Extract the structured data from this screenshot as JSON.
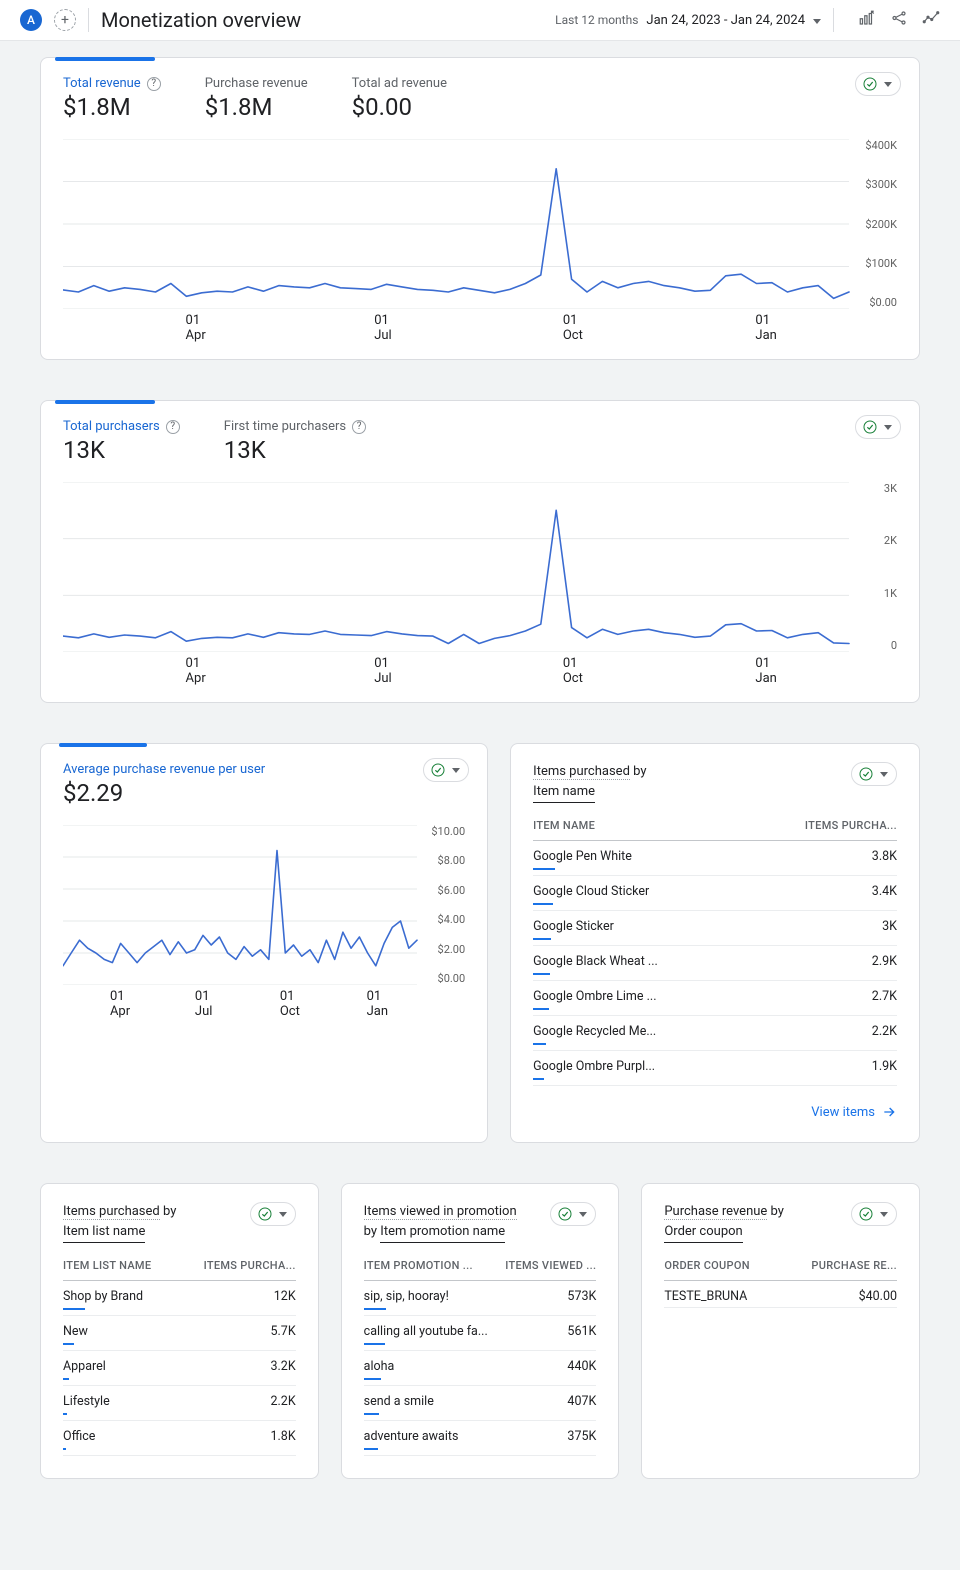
{
  "header": {
    "avatar_letter": "A",
    "title": "Monetization overview",
    "period_label": "Last 12 months",
    "date_range": "Jan 24, 2023 - Jan 24, 2024"
  },
  "card_revenue": {
    "metrics": [
      {
        "label": "Total revenue",
        "value": "$1.8M",
        "help": true,
        "active": true
      },
      {
        "label": "Purchase revenue",
        "value": "$1.8M",
        "help": false,
        "active": false
      },
      {
        "label": "Total ad revenue",
        "value": "$0.00",
        "help": false,
        "active": false
      }
    ]
  },
  "card_purchasers": {
    "metrics": [
      {
        "label": "Total purchasers",
        "value": "13K",
        "help": true,
        "active": true
      },
      {
        "label": "First time purchasers",
        "value": "13K",
        "help": true,
        "active": false
      }
    ]
  },
  "card_arpu": {
    "metrics": [
      {
        "label": "Average purchase revenue per user",
        "value": "$2.29",
        "help": false,
        "active": true
      }
    ]
  },
  "card_items_by_name": {
    "title_line1": "Items purchased",
    "title_joiner": "by",
    "title_line2": "Item name",
    "col1": "ITEM NAME",
    "col2": "ITEMS PURCHA...",
    "rows": [
      {
        "name": "Google Pen White",
        "value": "3.8K",
        "bar": 100
      },
      {
        "name": "Google Cloud Sticker",
        "value": "3.4K",
        "bar": 89
      },
      {
        "name": "Google Sticker",
        "value": "3K",
        "bar": 79
      },
      {
        "name": "Google Black Wheat ...",
        "value": "2.9K",
        "bar": 76
      },
      {
        "name": "Google Ombre Lime ...",
        "value": "2.7K",
        "bar": 71
      },
      {
        "name": "Google Recycled Me...",
        "value": "2.2K",
        "bar": 58
      },
      {
        "name": "Google Ombre Purpl...",
        "value": "1.9K",
        "bar": 50
      }
    ],
    "link": "View items"
  },
  "card_items_by_list": {
    "title_line1": "Items purchased",
    "title_joiner": "by",
    "title_line2": "Item list name",
    "col1": "ITEM LIST NAME",
    "col2": "ITEMS PURCHA...",
    "rows": [
      {
        "name": "Shop by Brand",
        "value": "12K",
        "bar": 100
      },
      {
        "name": "New",
        "value": "5.7K",
        "bar": 48
      },
      {
        "name": "Apparel",
        "value": "3.2K",
        "bar": 27
      },
      {
        "name": "Lifestyle",
        "value": "2.2K",
        "bar": 18
      },
      {
        "name": "Office",
        "value": "1.8K",
        "bar": 15
      }
    ]
  },
  "card_promo_views": {
    "title_line1": "Items viewed in promotion",
    "title_joiner": "by",
    "title_line2": "Item promotion name",
    "col1": "ITEM PROMOTION ...",
    "col2": "ITEMS VIEWED ...",
    "rows": [
      {
        "name": "sip, sip, hooray!",
        "value": "573K",
        "bar": 100
      },
      {
        "name": "calling all youtube fa...",
        "value": "561K",
        "bar": 98
      },
      {
        "name": "aloha",
        "value": "440K",
        "bar": 77
      },
      {
        "name": "send a smile",
        "value": "407K",
        "bar": 71
      },
      {
        "name": "adventure awaits",
        "value": "375K",
        "bar": 65
      }
    ]
  },
  "card_coupon": {
    "title_line1": "Purchase revenue",
    "title_joiner": "by",
    "title_line2": "Order coupon",
    "col1": "ORDER COUPON",
    "col2": "PURCHASE RE...",
    "rows": [
      {
        "name": "TESTE_BRUNA",
        "value": "$40.00",
        "bar": 0
      }
    ]
  },
  "chart_data": [
    {
      "id": "revenue",
      "type": "line",
      "title": "Total revenue",
      "x_ticks": [
        "01\nApr",
        "01\nJul",
        "01\nOct",
        "01\nJan"
      ],
      "ylim": [
        0,
        400000
      ],
      "y_labels": [
        "$400K",
        "$300K",
        "$200K",
        "$100K",
        "$0.00"
      ],
      "series": [
        {
          "name": "Total revenue",
          "values": [
            45000,
            40000,
            55000,
            42000,
            50000,
            46000,
            40000,
            60000,
            30000,
            38000,
            42000,
            40000,
            52000,
            42000,
            55000,
            52000,
            50000,
            60000,
            50000,
            48000,
            46000,
            58000,
            52000,
            46000,
            44000,
            40000,
            50000,
            44000,
            38000,
            46000,
            60000,
            80000,
            330000,
            70000,
            40000,
            65000,
            50000,
            60000,
            65000,
            55000,
            50000,
            42000,
            44000,
            78000,
            82000,
            60000,
            62000,
            40000,
            50000,
            55000,
            25000,
            40000
          ]
        }
      ]
    },
    {
      "id": "purchasers",
      "type": "line",
      "title": "Total purchasers",
      "x_ticks": [
        "01\nApr",
        "01\nJul",
        "01\nOct",
        "01\nJan"
      ],
      "ylim": [
        0,
        3000
      ],
      "y_labels": [
        "3K",
        "2K",
        "1K",
        "0"
      ],
      "series": [
        {
          "name": "Total purchasers",
          "values": [
            280,
            250,
            320,
            260,
            300,
            280,
            250,
            360,
            190,
            240,
            260,
            250,
            320,
            260,
            340,
            320,
            310,
            370,
            310,
            300,
            290,
            360,
            320,
            290,
            280,
            150,
            310,
            150,
            240,
            290,
            370,
            490,
            2500,
            430,
            250,
            400,
            310,
            370,
            400,
            340,
            310,
            260,
            280,
            480,
            500,
            370,
            380,
            250,
            310,
            340,
            160,
            150
          ]
        }
      ]
    },
    {
      "id": "arpu",
      "type": "line",
      "title": "Average purchase revenue per user",
      "x_ticks": [
        "01\nApr",
        "01\nJul",
        "01\nOct",
        "01\nJan"
      ],
      "ylim": [
        0,
        10
      ],
      "y_labels": [
        "$10.00",
        "$8.00",
        "$6.00",
        "$4.00",
        "$2.00",
        "$0.00"
      ],
      "series": [
        {
          "name": "ARPU",
          "values": [
            1.2,
            2.0,
            2.8,
            2.3,
            2.0,
            1.6,
            1.4,
            2.6,
            2.0,
            1.4,
            2.0,
            2.4,
            2.8,
            1.9,
            2.7,
            2.0,
            2.2,
            3.1,
            2.5,
            3.0,
            2.0,
            1.6,
            2.4,
            1.8,
            2.2,
            1.6,
            8.4,
            2.0,
            2.5,
            1.8,
            2.2,
            1.4,
            2.8,
            1.6,
            3.3,
            2.3,
            3.0,
            2.0,
            1.2,
            2.6,
            3.6,
            4.0,
            2.3,
            2.8
          ]
        }
      ]
    }
  ]
}
